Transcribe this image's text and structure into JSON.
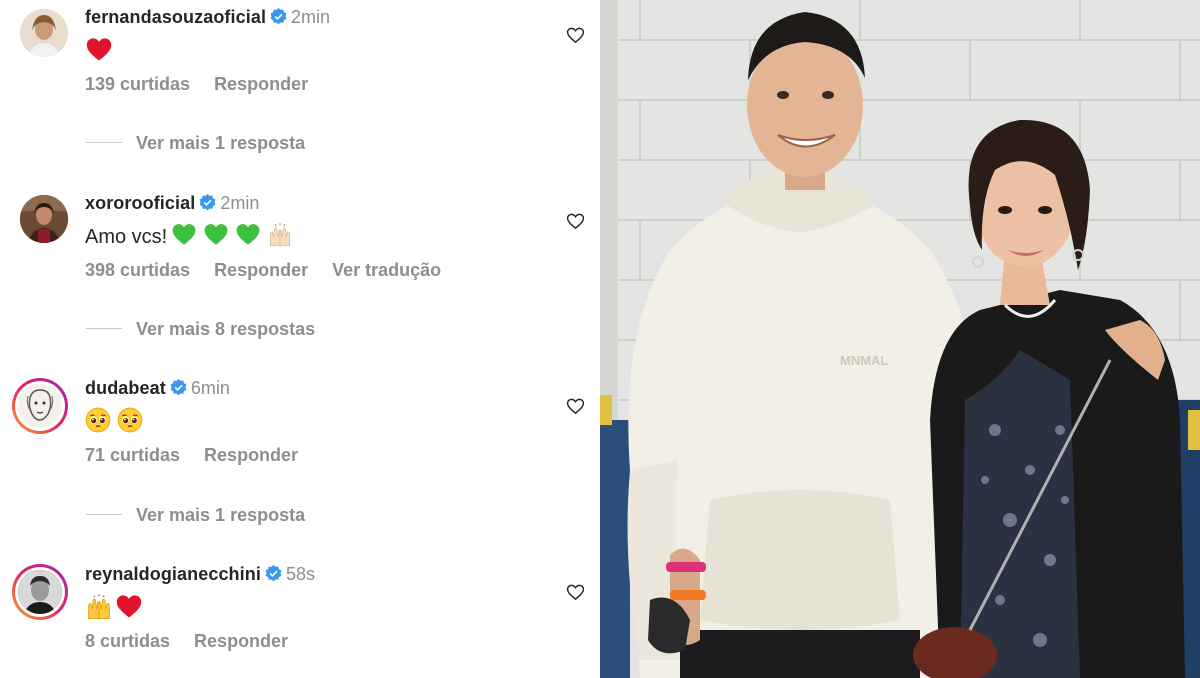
{
  "comments": [
    {
      "username": "fernandasouzaoficial",
      "time": "2min",
      "text": "",
      "emojis": [
        "red-heart"
      ],
      "likes": "139 curtidas",
      "reply": "Responder",
      "translate": "",
      "more_replies": "Ver mais 1 resposta"
    },
    {
      "username": "xororooficial",
      "time": "2min",
      "text": "Amo vcs!",
      "emojis": [
        "green-heart",
        "green-heart",
        "green-heart",
        "raising-hands"
      ],
      "likes": "398 curtidas",
      "reply": "Responder",
      "translate": "Ver tradução",
      "more_replies": "Ver mais 8 respostas"
    },
    {
      "username": "dudabeat",
      "time": "6min",
      "text": "",
      "emojis": [
        "pleading-face",
        "pleading-face"
      ],
      "likes": "71 curtidas",
      "reply": "Responder",
      "translate": "",
      "more_replies": "Ver mais 1 resposta"
    },
    {
      "username": "reynaldogianecchini",
      "time": "58s",
      "text": "",
      "emojis": [
        "raising-hands",
        "red-heart"
      ],
      "likes": "8 curtidas",
      "reply": "Responder",
      "translate": "",
      "more_replies": ""
    }
  ],
  "photo": {
    "print_on_hoodie": "MNMAL"
  },
  "colors": {
    "verified": "#3897f0",
    "muted": "#8e8e8e",
    "text": "#262626"
  }
}
